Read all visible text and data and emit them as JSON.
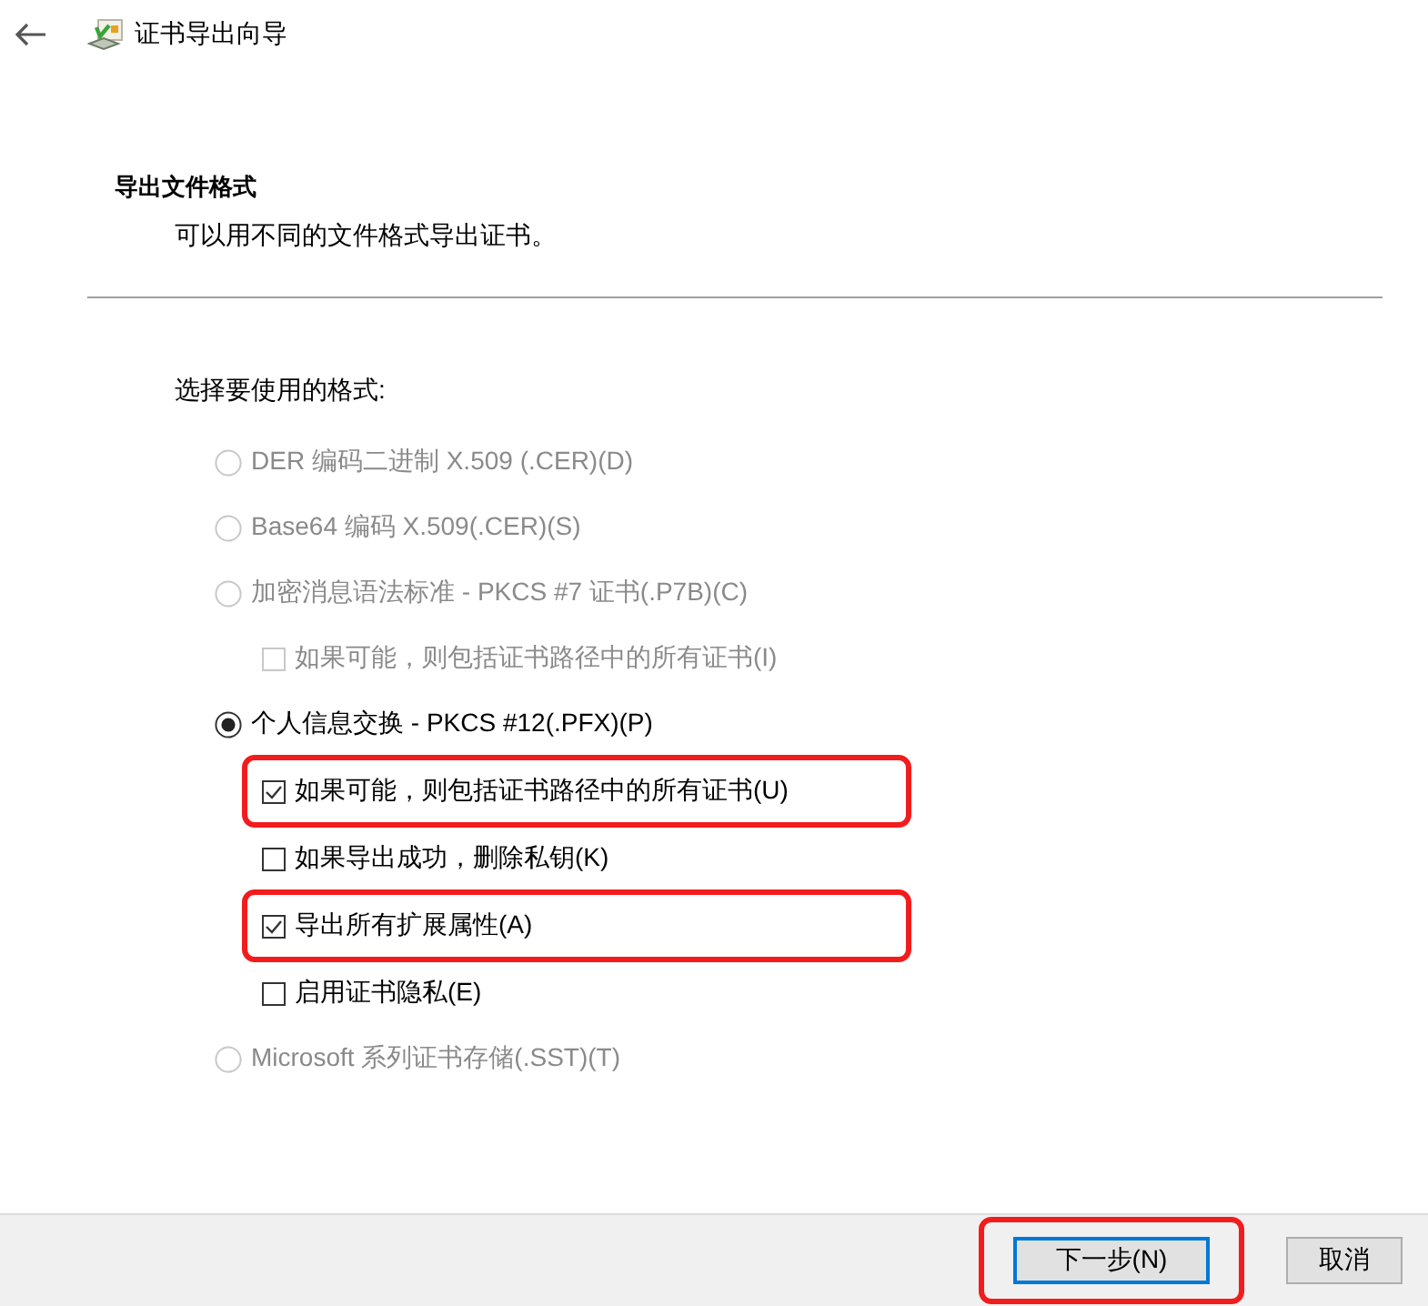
{
  "window": {
    "title": "证书导出向导"
  },
  "header": {
    "title": "导出文件格式",
    "subtitle": "可以用不同的文件格式导出证书。"
  },
  "prompt": "选择要使用的格式:",
  "options": [
    {
      "kind": "radio",
      "label": "DER 编码二进制 X.509 (.CER)(D)",
      "selected": false,
      "disabled": true,
      "highlighted": false
    },
    {
      "kind": "radio",
      "label": "Base64 编码 X.509(.CER)(S)",
      "selected": false,
      "disabled": true,
      "highlighted": false
    },
    {
      "kind": "radio",
      "label": "加密消息语法标准 - PKCS #7 证书(.P7B)(C)",
      "selected": false,
      "disabled": true,
      "highlighted": false
    },
    {
      "kind": "checkbox",
      "label": "如果可能，则包括证书路径中的所有证书(I)",
      "checked": false,
      "disabled": true,
      "highlighted": false
    },
    {
      "kind": "radio",
      "label": "个人信息交换 - PKCS #12(.PFX)(P)",
      "selected": true,
      "disabled": false,
      "highlighted": false
    },
    {
      "kind": "checkbox",
      "label": "如果可能，则包括证书路径中的所有证书(U)",
      "checked": true,
      "disabled": false,
      "highlighted": true
    },
    {
      "kind": "checkbox",
      "label": "如果导出成功，删除私钥(K)",
      "checked": false,
      "disabled": false,
      "highlighted": false
    },
    {
      "kind": "checkbox",
      "label": "导出所有扩展属性(A)",
      "checked": true,
      "disabled": false,
      "highlighted": true
    },
    {
      "kind": "checkbox",
      "label": "启用证书隐私(E)",
      "checked": false,
      "disabled": false,
      "highlighted": false
    },
    {
      "kind": "radio",
      "label": "Microsoft 系列证书存储(.SST)(T)",
      "selected": false,
      "disabled": true,
      "highlighted": false
    }
  ],
  "buttons": [
    {
      "label": "下一步(N)",
      "default": true,
      "highlighted": true
    },
    {
      "label": "取消",
      "default": false,
      "highlighted": false
    }
  ]
}
